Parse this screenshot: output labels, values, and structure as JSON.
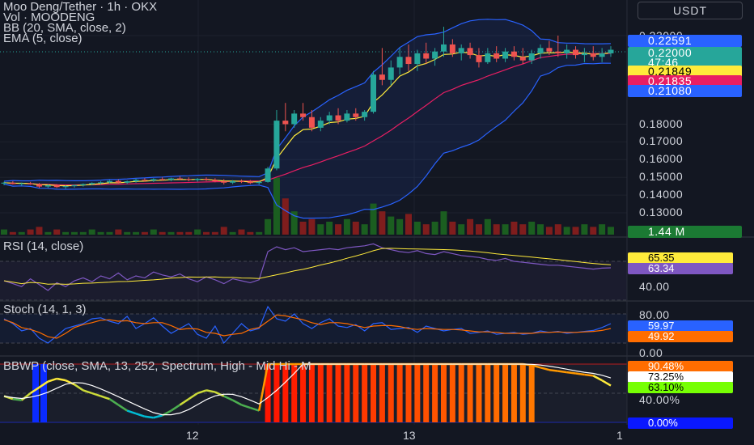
{
  "header": {
    "title": "Moo Deng/Tether · 1h · OKX",
    "currency": "USDT"
  },
  "legend": {
    "vol": "Vol · MOODENG",
    "bb": "BB (20, SMA, close, 2)",
    "ema": "EMA (5, close)"
  },
  "price_axis": {
    "ticks": [
      "0.23000",
      "0.18000",
      "0.17000",
      "0.16000",
      "0.15000",
      "0.14000",
      "0.13000"
    ],
    "bb_upper": "0.22591",
    "last": "0.22000",
    "countdown": "47:46",
    "ema": "0.21849",
    "bb_basis": "0.21835",
    "bb_lower": "0.21080",
    "volume": "1.44 M"
  },
  "rsi": {
    "label": "RSI (14, close)",
    "tick": "40.00",
    "ma_value": "65.35",
    "value": "63.34"
  },
  "stoch": {
    "label": "Stoch (14, 1, 3)",
    "ticks": [
      "80.00",
      "0.00"
    ],
    "k": "59.97",
    "d": "49.92"
  },
  "bbwp": {
    "label": "BBWP (close, SMA, 13, 252, Spectrum, High - Mid Hi - M",
    "ticks": [
      "40.00%"
    ],
    "high": "90.48%",
    "ma": "73.25%",
    "value": "63.10%",
    "low": "0.00%"
  },
  "time_axis": [
    "12",
    "13",
    "1"
  ],
  "colors": {
    "bg": "#131722",
    "up": "#26a69a",
    "down": "#ef5350",
    "bb": "#2962ff",
    "ema": "#ffeb3b",
    "basis": "#e91e63",
    "rsi": "#7e57c2",
    "stoch_k": "#2962ff",
    "stoch_d": "#ff6d00"
  },
  "chart_data": {
    "type": "candlestick",
    "candles": [
      [
        0.1465,
        0.1475,
        0.1455,
        0.147
      ],
      [
        0.147,
        0.1478,
        0.146,
        0.1462
      ],
      [
        0.1462,
        0.147,
        0.1452,
        0.1466
      ],
      [
        0.1466,
        0.1474,
        0.1458,
        0.146
      ],
      [
        0.146,
        0.1468,
        0.144,
        0.1448
      ],
      [
        0.1448,
        0.146,
        0.144,
        0.1455
      ],
      [
        0.1455,
        0.1462,
        0.144,
        0.1445
      ],
      [
        0.1445,
        0.1455,
        0.1436,
        0.145
      ],
      [
        0.145,
        0.146,
        0.1442,
        0.1456
      ],
      [
        0.1456,
        0.1466,
        0.1448,
        0.1462
      ],
      [
        0.1462,
        0.1472,
        0.1455,
        0.1468
      ],
      [
        0.1468,
        0.1478,
        0.146,
        0.1472
      ],
      [
        0.1472,
        0.1485,
        0.1466,
        0.148
      ],
      [
        0.148,
        0.1488,
        0.1465,
        0.147
      ],
      [
        0.147,
        0.1482,
        0.1462,
        0.1478
      ],
      [
        0.1478,
        0.1492,
        0.147,
        0.1486
      ],
      [
        0.1486,
        0.1495,
        0.1475,
        0.1482
      ],
      [
        0.1482,
        0.1495,
        0.1474,
        0.149
      ],
      [
        0.149,
        0.15,
        0.148,
        0.1486
      ],
      [
        0.1486,
        0.1498,
        0.1478,
        0.1494
      ],
      [
        0.1494,
        0.1505,
        0.1484,
        0.149
      ],
      [
        0.149,
        0.15,
        0.1478,
        0.1485
      ],
      [
        0.1485,
        0.1496,
        0.1476,
        0.1492
      ],
      [
        0.1492,
        0.15,
        0.148,
        0.1486
      ],
      [
        0.1486,
        0.1495,
        0.1472,
        0.1478
      ],
      [
        0.1478,
        0.149,
        0.146,
        0.147
      ],
      [
        0.147,
        0.1484,
        0.1462,
        0.1478
      ],
      [
        0.1478,
        0.1488,
        0.1468,
        0.1475
      ],
      [
        0.1475,
        0.1485,
        0.1462,
        0.1468
      ],
      [
        0.1468,
        0.148,
        0.146,
        0.1474
      ],
      [
        0.1474,
        0.156,
        0.147,
        0.155
      ],
      [
        0.155,
        0.188,
        0.154,
        0.182
      ],
      [
        0.182,
        0.192,
        0.176,
        0.18
      ],
      [
        0.18,
        0.188,
        0.178,
        0.186
      ],
      [
        0.186,
        0.192,
        0.182,
        0.184
      ],
      [
        0.184,
        0.188,
        0.176,
        0.178
      ],
      [
        0.178,
        0.184,
        0.176,
        0.182
      ],
      [
        0.182,
        0.187,
        0.18,
        0.185
      ],
      [
        0.185,
        0.189,
        0.18,
        0.182
      ],
      [
        0.182,
        0.188,
        0.181,
        0.186
      ],
      [
        0.186,
        0.189,
        0.182,
        0.184
      ],
      [
        0.184,
        0.188,
        0.182,
        0.187
      ],
      [
        0.187,
        0.21,
        0.186,
        0.208
      ],
      [
        0.208,
        0.223,
        0.202,
        0.205
      ],
      [
        0.205,
        0.216,
        0.202,
        0.212
      ],
      [
        0.212,
        0.223,
        0.208,
        0.218
      ],
      [
        0.218,
        0.225,
        0.21,
        0.214
      ],
      [
        0.214,
        0.222,
        0.21,
        0.22
      ],
      [
        0.22,
        0.226,
        0.214,
        0.217
      ],
      [
        0.217,
        0.223,
        0.213,
        0.221
      ],
      [
        0.221,
        0.235,
        0.218,
        0.225
      ],
      [
        0.225,
        0.228,
        0.218,
        0.22
      ],
      [
        0.22,
        0.225,
        0.216,
        0.223
      ],
      [
        0.223,
        0.226,
        0.217,
        0.219
      ],
      [
        0.219,
        0.223,
        0.212,
        0.215
      ],
      [
        0.215,
        0.223,
        0.214,
        0.22
      ],
      [
        0.22,
        0.224,
        0.215,
        0.217
      ],
      [
        0.217,
        0.223,
        0.215,
        0.221
      ],
      [
        0.221,
        0.224,
        0.216,
        0.218
      ],
      [
        0.218,
        0.223,
        0.214,
        0.216
      ],
      [
        0.216,
        0.222,
        0.214,
        0.22
      ],
      [
        0.22,
        0.225,
        0.217,
        0.223
      ],
      [
        0.223,
        0.227,
        0.219,
        0.221
      ],
      [
        0.221,
        0.23,
        0.218,
        0.22
      ],
      [
        0.22,
        0.225,
        0.217,
        0.222
      ],
      [
        0.222,
        0.224,
        0.217,
        0.219
      ],
      [
        0.219,
        0.223,
        0.215,
        0.22
      ],
      [
        0.22,
        0.224,
        0.216,
        0.218
      ],
      [
        0.218,
        0.223,
        0.215,
        0.22
      ],
      [
        0.22,
        0.224,
        0.218,
        0.222
      ]
    ],
    "volume": [
      2,
      1,
      1,
      2,
      3,
      1,
      2,
      1,
      1,
      1,
      2,
      1,
      1,
      2,
      1,
      1,
      1,
      2,
      1,
      1,
      1,
      1,
      2,
      1,
      1,
      3,
      1,
      2,
      1,
      1,
      6,
      22,
      14,
      9,
      5,
      6,
      4,
      5,
      4,
      6,
      5,
      4,
      12,
      9,
      7,
      6,
      8,
      5,
      4,
      5,
      9,
      5,
      4,
      6,
      4,
      6,
      4,
      4,
      5,
      4,
      5,
      4,
      3,
      4,
      3,
      3,
      4,
      3,
      4,
      3
    ],
    "rsi": [
      50,
      47,
      44,
      52,
      46,
      40,
      48,
      44,
      50,
      53,
      49,
      55,
      52,
      58,
      51,
      55,
      53,
      59,
      56,
      54,
      57,
      52,
      49,
      54,
      51,
      47,
      52,
      50,
      48,
      51,
      80,
      85,
      82,
      84,
      80,
      81,
      82,
      83,
      82,
      84,
      85,
      86,
      88,
      84,
      82,
      80,
      79,
      81,
      78,
      77,
      80,
      78,
      76,
      75,
      74,
      72,
      71,
      73,
      70,
      69,
      68,
      67,
      66,
      66,
      65,
      64,
      63,
      62,
      63,
      63.34
    ],
    "stoch_k": [
      70,
      60,
      45,
      50,
      30,
      20,
      35,
      50,
      55,
      60,
      70,
      72,
      65,
      60,
      75,
      50,
      60,
      72,
      55,
      40,
      50,
      60,
      38,
      30,
      55,
      20,
      40,
      60,
      45,
      50,
      95,
      70,
      65,
      80,
      60,
      50,
      62,
      70,
      55,
      52,
      58,
      45,
      60,
      62,
      48,
      50,
      52,
      42,
      55,
      50,
      45,
      48,
      50,
      40,
      42,
      45,
      38,
      40,
      42,
      38,
      40,
      45,
      42,
      44,
      40,
      42,
      44,
      46,
      52,
      59.97
    ],
    "stoch_d": [
      68,
      62,
      52,
      48,
      42,
      33,
      30,
      40,
      52,
      58,
      62,
      67,
      68,
      65,
      66,
      62,
      60,
      62,
      62,
      56,
      48,
      50,
      49,
      42,
      40,
      35,
      38,
      40,
      48,
      52,
      65,
      78,
      76,
      72,
      68,
      62,
      58,
      62,
      62,
      60,
      56,
      52,
      55,
      56,
      56,
      54,
      50,
      48,
      50,
      49,
      48,
      48,
      47,
      45,
      43,
      43,
      42,
      40,
      40,
      40,
      40,
      42,
      42,
      43,
      42,
      42,
      43,
      44,
      46,
      49.92
    ],
    "bbwp": [
      45,
      40,
      38,
      50,
      60,
      70,
      75,
      72,
      65,
      55,
      50,
      45,
      40,
      30,
      20,
      15,
      10,
      8,
      12,
      20,
      30,
      40,
      50,
      55,
      52,
      45,
      38,
      30,
      25,
      20,
      100,
      100,
      100,
      100,
      100,
      100,
      100,
      100,
      100,
      100,
      100,
      100,
      100,
      100,
      100,
      100,
      100,
      100,
      100,
      100,
      100,
      100,
      100,
      100,
      100,
      100,
      100,
      100,
      100,
      100,
      98,
      94,
      90,
      88,
      86,
      84,
      82,
      80,
      72,
      63.1
    ]
  }
}
